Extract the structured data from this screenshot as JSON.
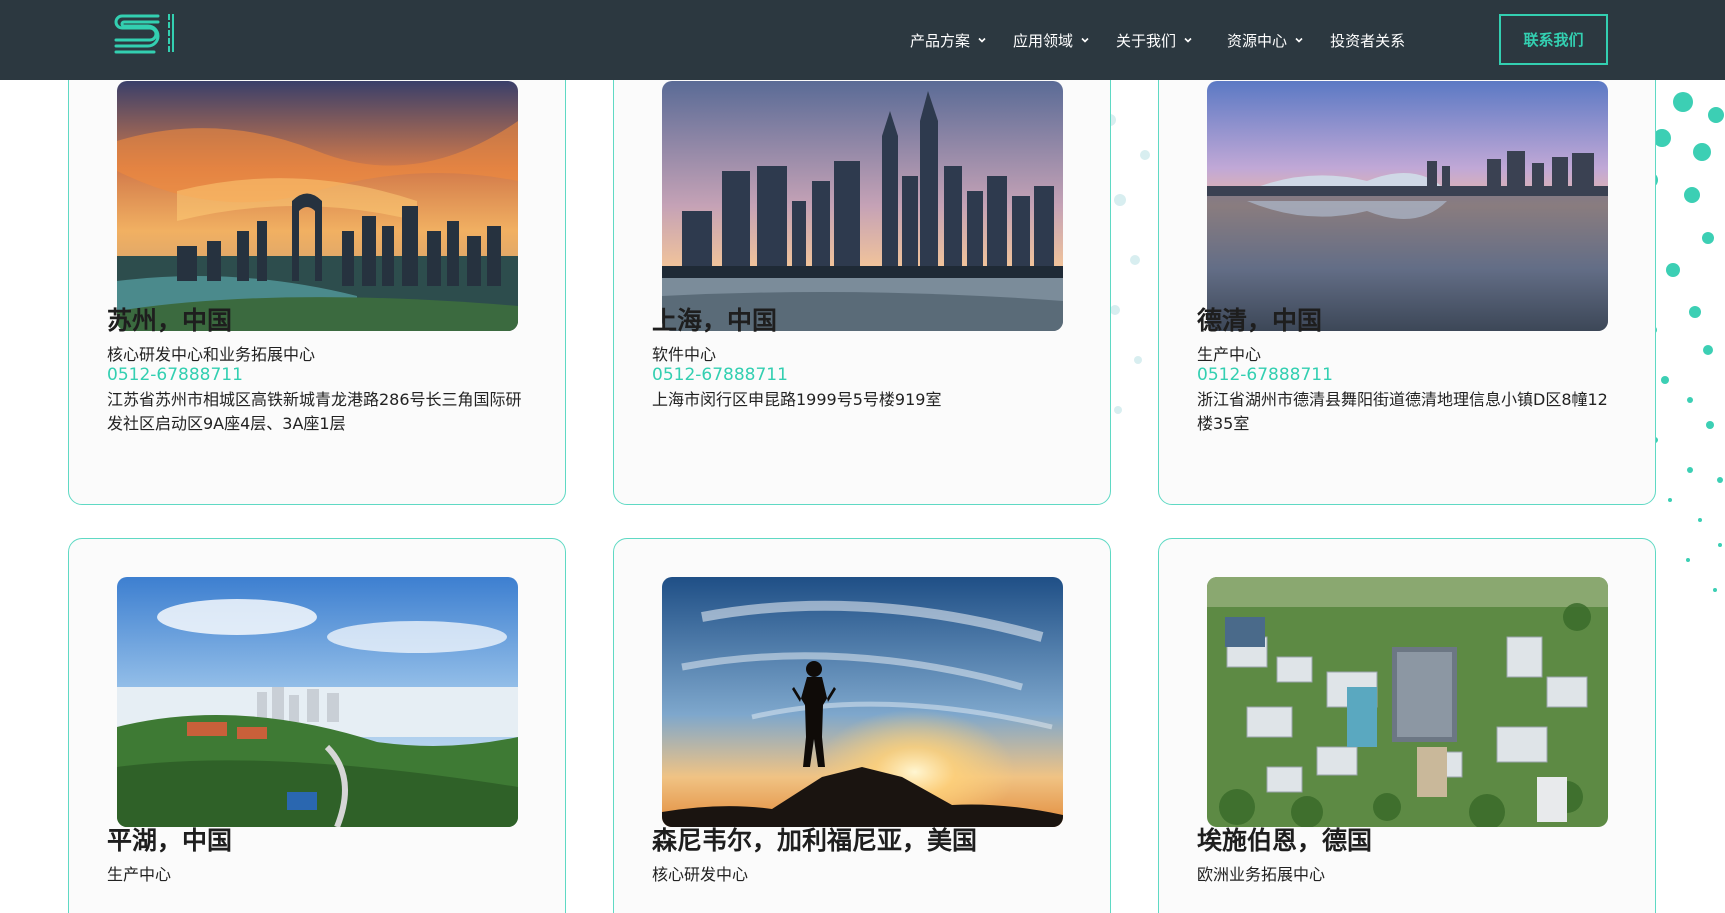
{
  "header": {
    "nav": [
      {
        "label": "产品方案",
        "has_dropdown": true
      },
      {
        "label": "应用领域",
        "has_dropdown": true
      },
      {
        "label": "关于我们",
        "has_dropdown": true
      },
      {
        "label": "资源中心",
        "has_dropdown": true
      },
      {
        "label": "投资者关系",
        "has_dropdown": false
      }
    ],
    "contact_label": "联系我们",
    "accent_color": "#33cfb1",
    "background_color": "#2c3840",
    "logo_icon": "seyond-logo-icon"
  },
  "locations": [
    {
      "title": "苏州，中国",
      "role": "核心研发中心和业务拓展中心",
      "phone": "0512-67888711",
      "address": "江苏省苏州市相城区高铁新城青龙港路286号长三角国际研发社区启动区9A座4层、3A座1层",
      "photo_icon": "suzhou-skyline-photo"
    },
    {
      "title": "上海，中国",
      "role": "软件中心",
      "phone": "0512-67888711",
      "address": "上海市闵行区申昆路1999号5号楼919室",
      "photo_icon": "shanghai-skyline-photo"
    },
    {
      "title": "德清，中国",
      "role": "生产中心",
      "phone": "0512-67888711",
      "address": "浙江省湖州市德清县舞阳街道德清地理信息小镇D区8幢12楼35室",
      "photo_icon": "deqing-lake-photo"
    },
    {
      "title": "平湖，中国",
      "role": "生产中心",
      "photo_icon": "pinghu-hills-photo"
    },
    {
      "title": "森尼韦尔，加利福尼亚，美国",
      "role": "核心研发中心",
      "photo_icon": "sunnyvale-silhouette-photo"
    },
    {
      "title": "埃施伯恩，德国",
      "role": "欧洲业务拓展中心",
      "photo_icon": "eschborn-aerial-photo"
    }
  ]
}
